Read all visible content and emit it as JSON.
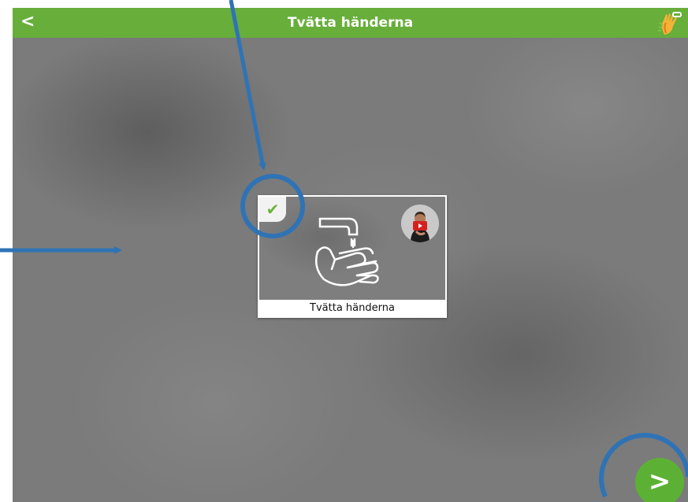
{
  "header": {
    "back_label": "<",
    "title": "Tvätta händerna",
    "app_icon": "hand-sign-icon"
  },
  "card": {
    "checked": true,
    "check_icon": "checkmark-icon",
    "pictogram": "washing-hands-pictogram",
    "video_icon": "sign-language-video-icon",
    "label": "Tvätta händerna"
  },
  "footer": {
    "next_label": ">"
  },
  "colors": {
    "accent_green": "#67ae3b",
    "next_button_green": "#5cb135",
    "check_green": "#6ab53b",
    "annotation_blue": "#2f73b5"
  }
}
